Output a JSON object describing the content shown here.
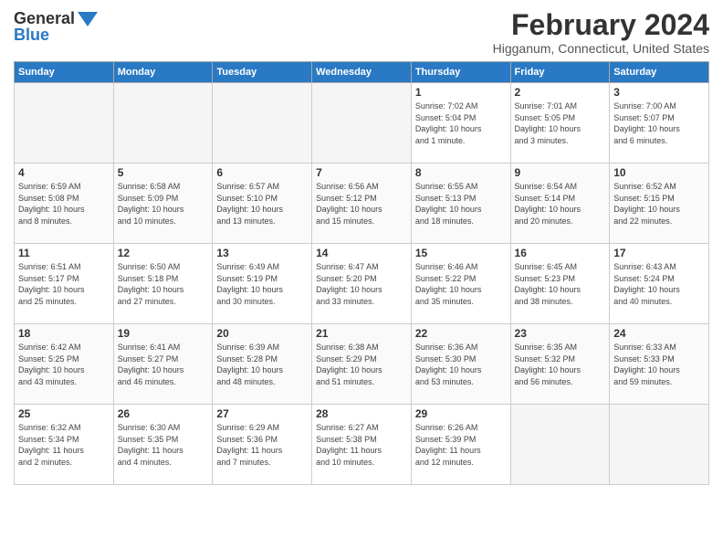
{
  "header": {
    "logo_line1": "General",
    "logo_line2": "Blue",
    "title": "February 2024",
    "subtitle": "Higganum, Connecticut, United States"
  },
  "days_of_week": [
    "Sunday",
    "Monday",
    "Tuesday",
    "Wednesday",
    "Thursday",
    "Friday",
    "Saturday"
  ],
  "weeks": [
    [
      {
        "num": "",
        "info": ""
      },
      {
        "num": "",
        "info": ""
      },
      {
        "num": "",
        "info": ""
      },
      {
        "num": "",
        "info": ""
      },
      {
        "num": "1",
        "info": "Sunrise: 7:02 AM\nSunset: 5:04 PM\nDaylight: 10 hours\nand 1 minute."
      },
      {
        "num": "2",
        "info": "Sunrise: 7:01 AM\nSunset: 5:05 PM\nDaylight: 10 hours\nand 3 minutes."
      },
      {
        "num": "3",
        "info": "Sunrise: 7:00 AM\nSunset: 5:07 PM\nDaylight: 10 hours\nand 6 minutes."
      }
    ],
    [
      {
        "num": "4",
        "info": "Sunrise: 6:59 AM\nSunset: 5:08 PM\nDaylight: 10 hours\nand 8 minutes."
      },
      {
        "num": "5",
        "info": "Sunrise: 6:58 AM\nSunset: 5:09 PM\nDaylight: 10 hours\nand 10 minutes."
      },
      {
        "num": "6",
        "info": "Sunrise: 6:57 AM\nSunset: 5:10 PM\nDaylight: 10 hours\nand 13 minutes."
      },
      {
        "num": "7",
        "info": "Sunrise: 6:56 AM\nSunset: 5:12 PM\nDaylight: 10 hours\nand 15 minutes."
      },
      {
        "num": "8",
        "info": "Sunrise: 6:55 AM\nSunset: 5:13 PM\nDaylight: 10 hours\nand 18 minutes."
      },
      {
        "num": "9",
        "info": "Sunrise: 6:54 AM\nSunset: 5:14 PM\nDaylight: 10 hours\nand 20 minutes."
      },
      {
        "num": "10",
        "info": "Sunrise: 6:52 AM\nSunset: 5:15 PM\nDaylight: 10 hours\nand 22 minutes."
      }
    ],
    [
      {
        "num": "11",
        "info": "Sunrise: 6:51 AM\nSunset: 5:17 PM\nDaylight: 10 hours\nand 25 minutes."
      },
      {
        "num": "12",
        "info": "Sunrise: 6:50 AM\nSunset: 5:18 PM\nDaylight: 10 hours\nand 27 minutes."
      },
      {
        "num": "13",
        "info": "Sunrise: 6:49 AM\nSunset: 5:19 PM\nDaylight: 10 hours\nand 30 minutes."
      },
      {
        "num": "14",
        "info": "Sunrise: 6:47 AM\nSunset: 5:20 PM\nDaylight: 10 hours\nand 33 minutes."
      },
      {
        "num": "15",
        "info": "Sunrise: 6:46 AM\nSunset: 5:22 PM\nDaylight: 10 hours\nand 35 minutes."
      },
      {
        "num": "16",
        "info": "Sunrise: 6:45 AM\nSunset: 5:23 PM\nDaylight: 10 hours\nand 38 minutes."
      },
      {
        "num": "17",
        "info": "Sunrise: 6:43 AM\nSunset: 5:24 PM\nDaylight: 10 hours\nand 40 minutes."
      }
    ],
    [
      {
        "num": "18",
        "info": "Sunrise: 6:42 AM\nSunset: 5:25 PM\nDaylight: 10 hours\nand 43 minutes."
      },
      {
        "num": "19",
        "info": "Sunrise: 6:41 AM\nSunset: 5:27 PM\nDaylight: 10 hours\nand 46 minutes."
      },
      {
        "num": "20",
        "info": "Sunrise: 6:39 AM\nSunset: 5:28 PM\nDaylight: 10 hours\nand 48 minutes."
      },
      {
        "num": "21",
        "info": "Sunrise: 6:38 AM\nSunset: 5:29 PM\nDaylight: 10 hours\nand 51 minutes."
      },
      {
        "num": "22",
        "info": "Sunrise: 6:36 AM\nSunset: 5:30 PM\nDaylight: 10 hours\nand 53 minutes."
      },
      {
        "num": "23",
        "info": "Sunrise: 6:35 AM\nSunset: 5:32 PM\nDaylight: 10 hours\nand 56 minutes."
      },
      {
        "num": "24",
        "info": "Sunrise: 6:33 AM\nSunset: 5:33 PM\nDaylight: 10 hours\nand 59 minutes."
      }
    ],
    [
      {
        "num": "25",
        "info": "Sunrise: 6:32 AM\nSunset: 5:34 PM\nDaylight: 11 hours\nand 2 minutes."
      },
      {
        "num": "26",
        "info": "Sunrise: 6:30 AM\nSunset: 5:35 PM\nDaylight: 11 hours\nand 4 minutes."
      },
      {
        "num": "27",
        "info": "Sunrise: 6:29 AM\nSunset: 5:36 PM\nDaylight: 11 hours\nand 7 minutes."
      },
      {
        "num": "28",
        "info": "Sunrise: 6:27 AM\nSunset: 5:38 PM\nDaylight: 11 hours\nand 10 minutes."
      },
      {
        "num": "29",
        "info": "Sunrise: 6:26 AM\nSunset: 5:39 PM\nDaylight: 11 hours\nand 12 minutes."
      },
      {
        "num": "",
        "info": ""
      },
      {
        "num": "",
        "info": ""
      }
    ]
  ]
}
